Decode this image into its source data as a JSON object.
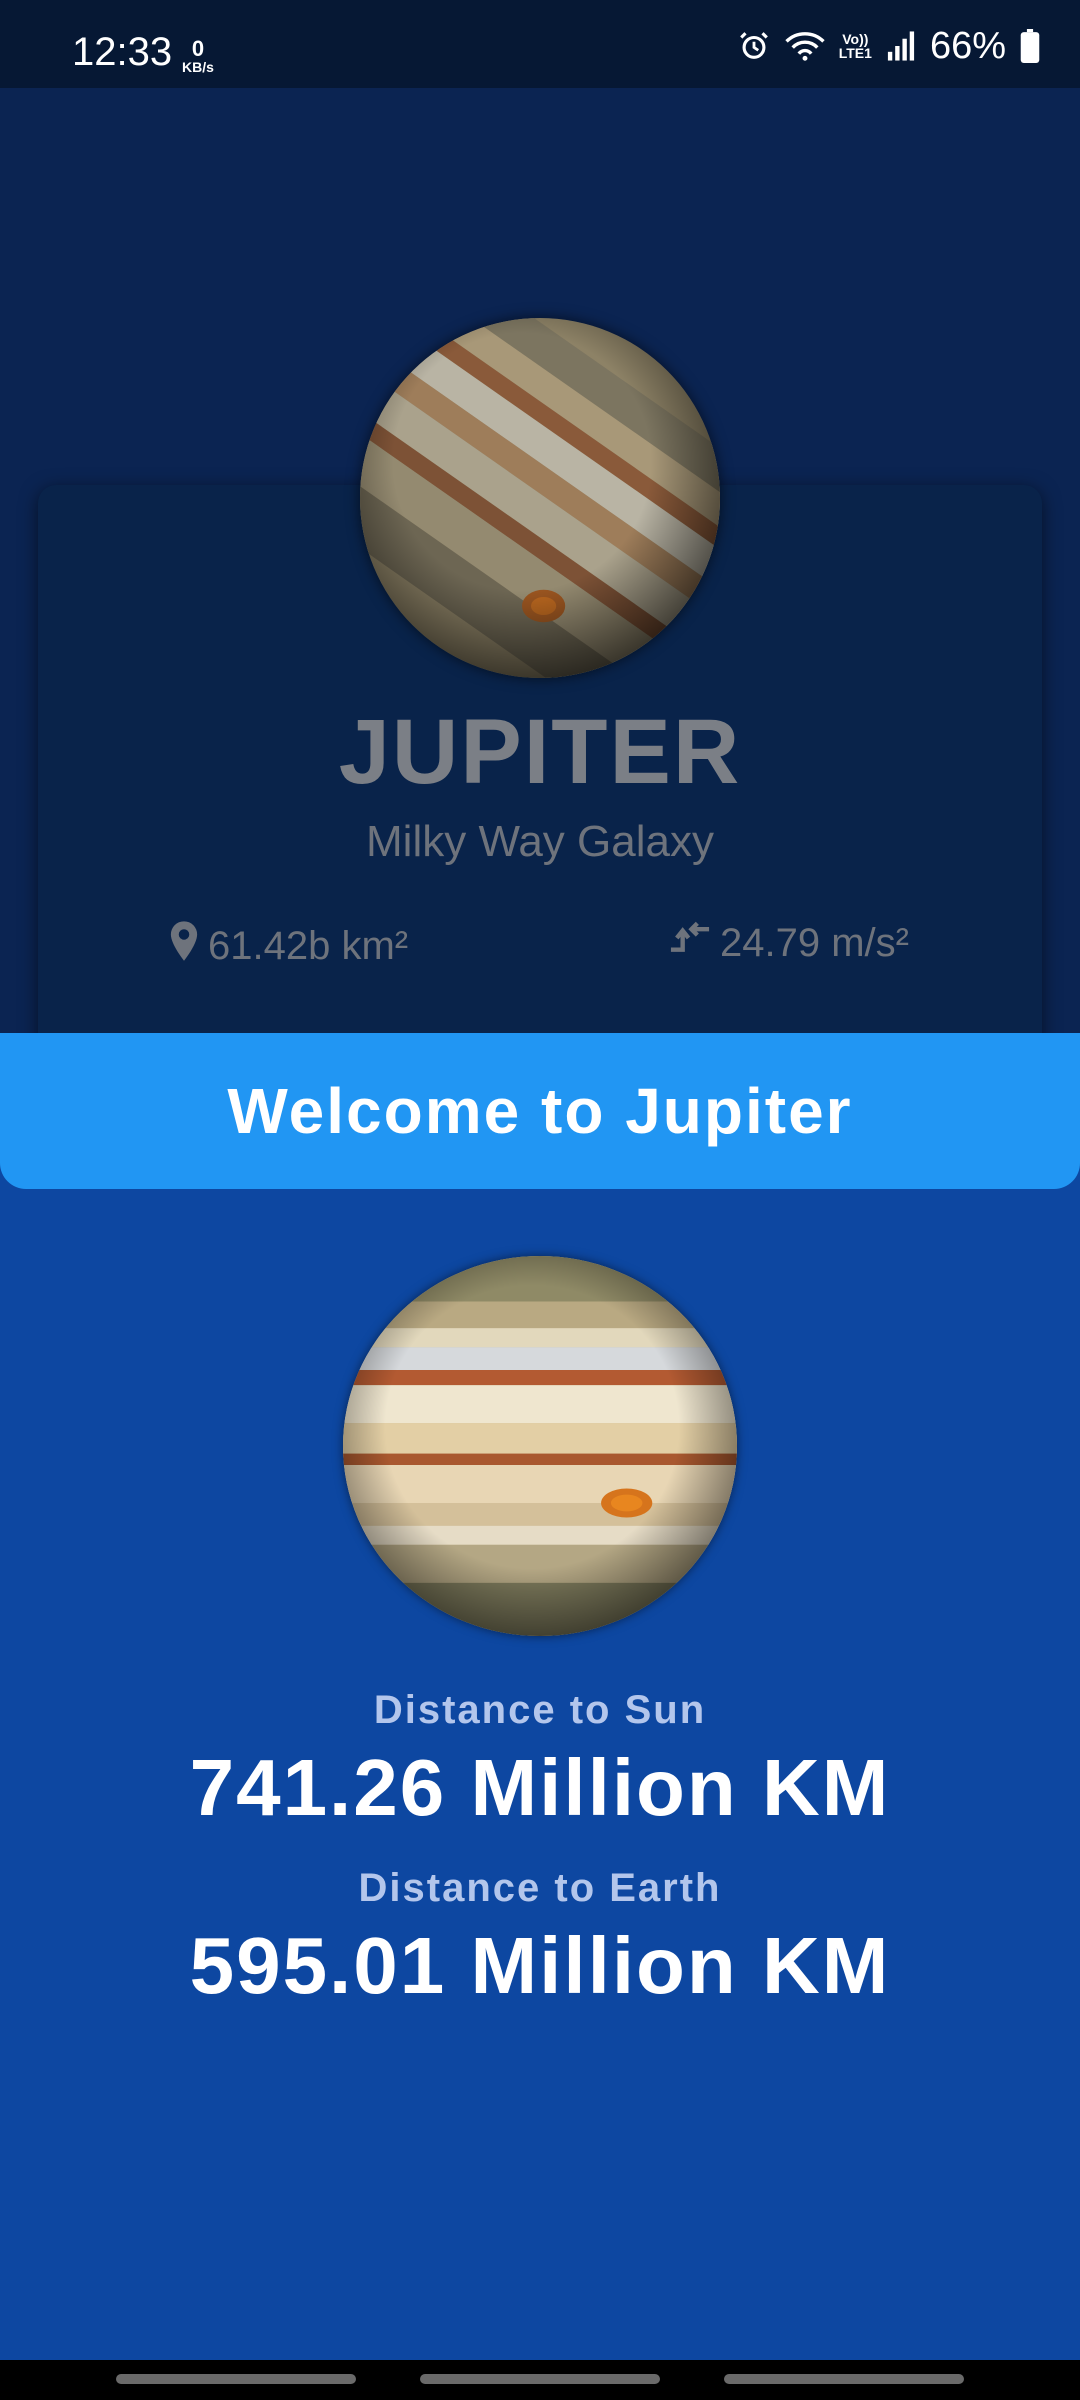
{
  "status_bar": {
    "time": "12:33",
    "net_speed_value": "0",
    "net_speed_unit": "KB/s",
    "volte_label": "Vo))",
    "lte_label": "LTE1",
    "battery_percent": "66%",
    "icons": [
      "alarm-icon",
      "wifi-icon",
      "signal-icon",
      "battery-icon"
    ]
  },
  "planet_card": {
    "name": "JUPITER",
    "galaxy": "Milky Way Galaxy",
    "area": "61.42b km²",
    "area_icon": "location-pin-icon",
    "gravity": "24.79 m/s²",
    "gravity_icon": "merge-arrows-icon"
  },
  "banner": {
    "title": "Welcome to Jupiter"
  },
  "details": {
    "distance_sun_label": "Distance to Sun",
    "distance_sun_value": "741.26 Million KM",
    "distance_earth_label": "Distance to Earth",
    "distance_earth_value": "595.01 Million KM"
  },
  "colors": {
    "background": "#0d47a1",
    "banner": "#2196f3",
    "overlay": "#0b2452",
    "status_bar": "#061834"
  }
}
